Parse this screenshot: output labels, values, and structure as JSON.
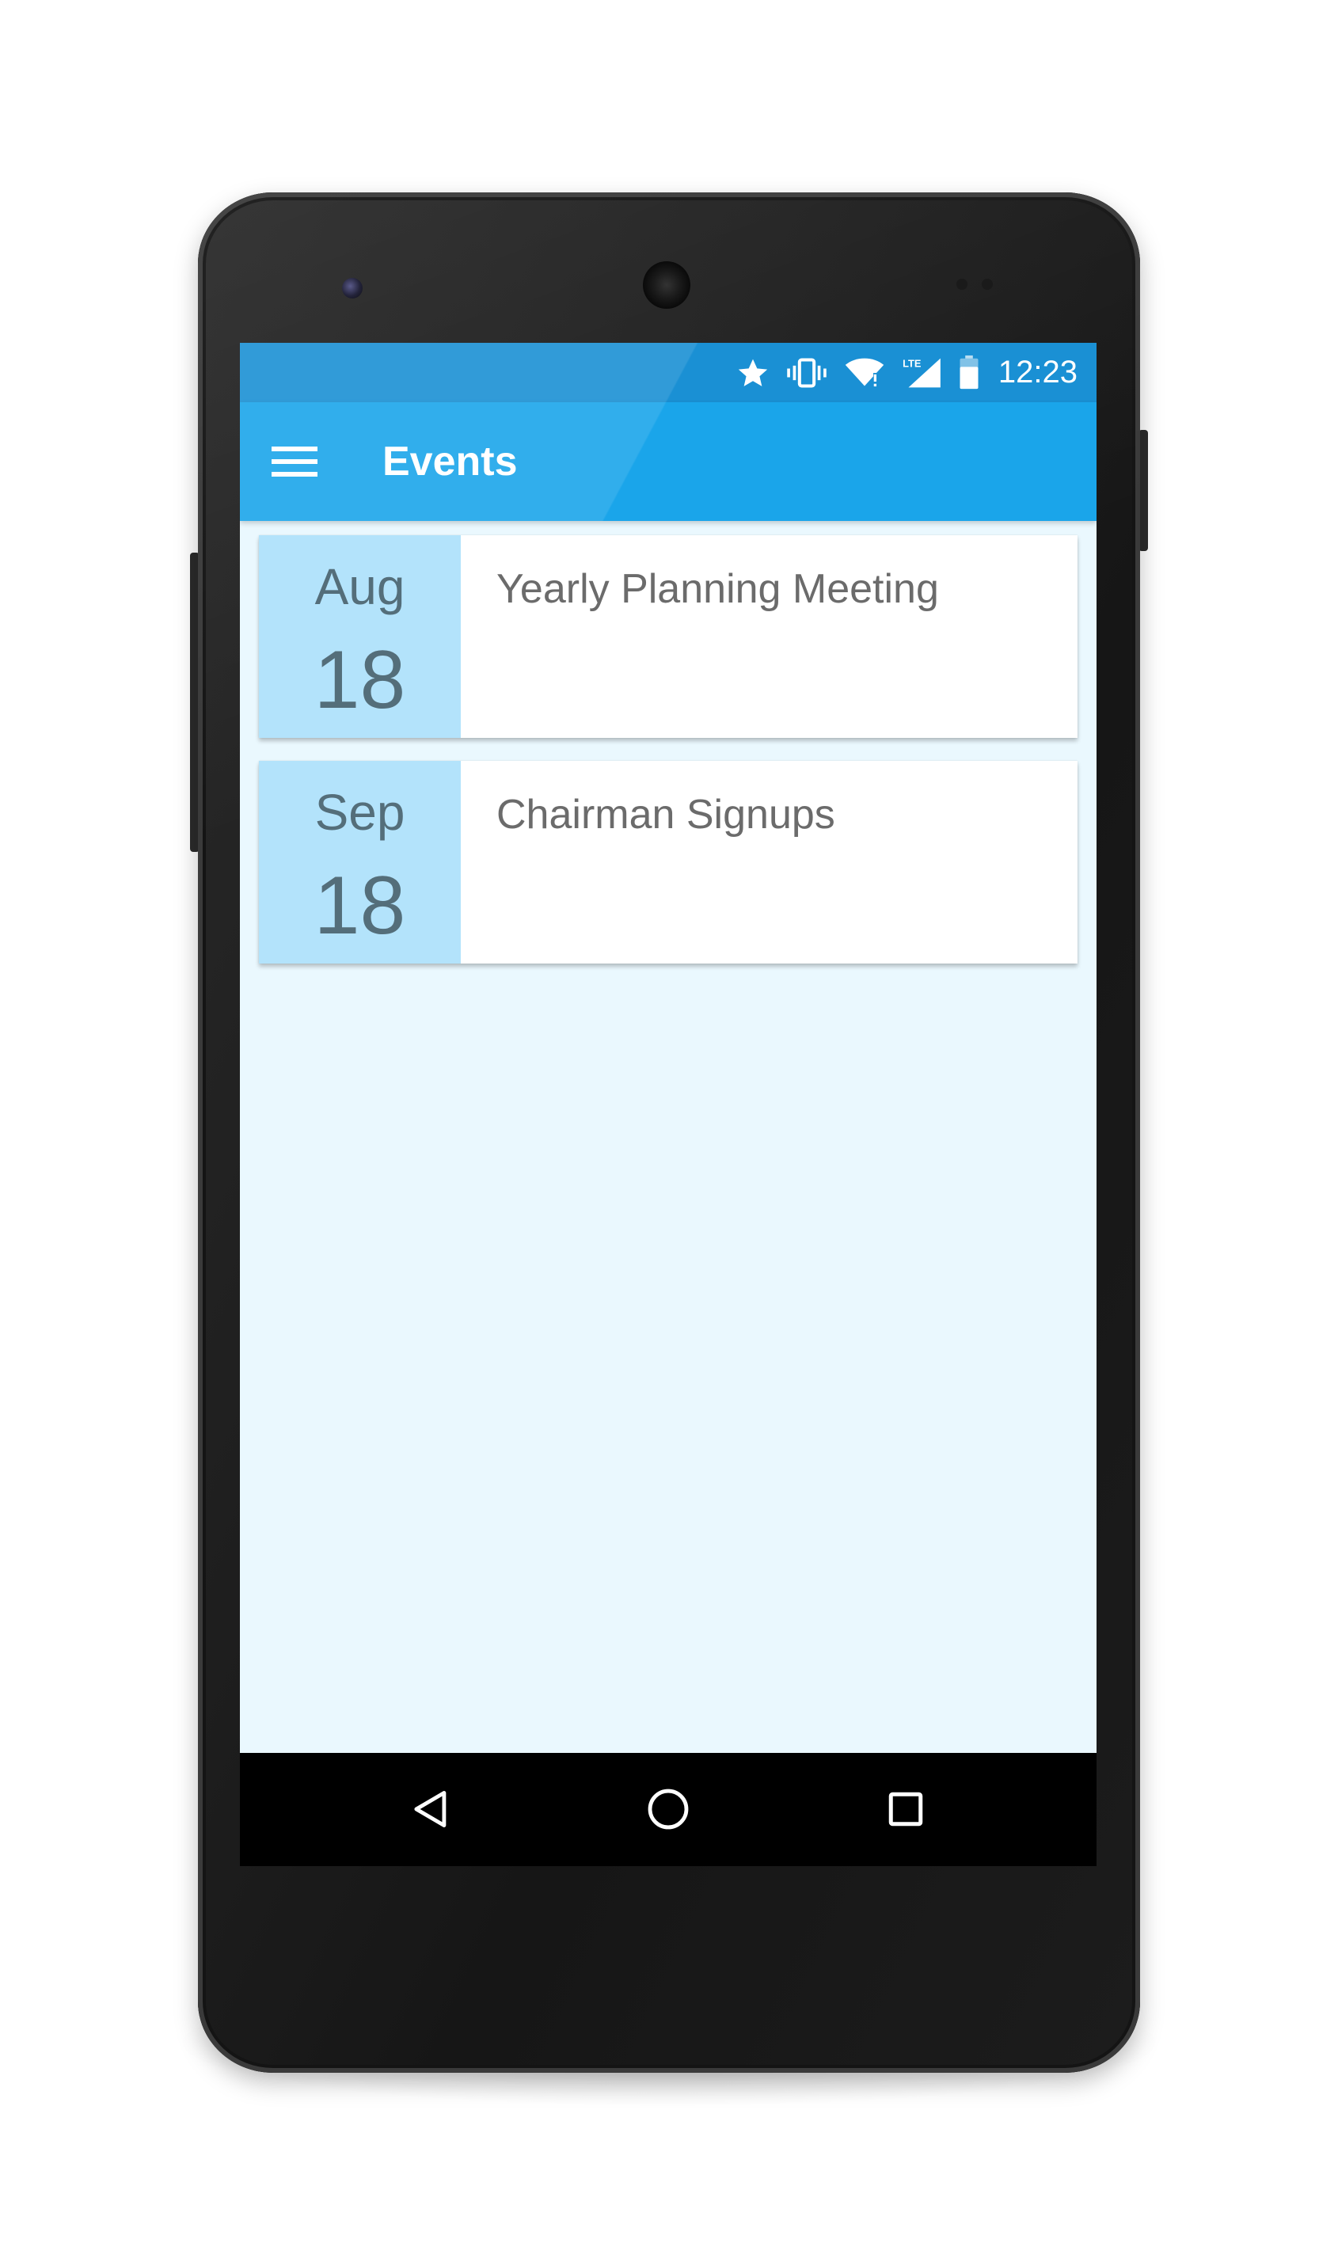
{
  "status_bar": {
    "time": "12:23",
    "network_label": "LTE"
  },
  "app_bar": {
    "title": "Events"
  },
  "events": [
    {
      "month": "Aug",
      "day": "18",
      "title": "Yearly Planning Meeting"
    },
    {
      "month": "Sep",
      "day": "18",
      "title": "Chairman Signups"
    }
  ],
  "icons": {
    "status": [
      "star-icon",
      "vibrate-icon",
      "wifi-icon",
      "lte-signal-icon",
      "battery-icon"
    ],
    "app_bar": [
      "menu-icon"
    ],
    "nav": [
      "back-icon",
      "home-icon",
      "recents-icon"
    ]
  },
  "colors": {
    "status_bar": "#1a90d4",
    "app_bar": "#1aa5ea",
    "screen_background": "#eaf8fe",
    "date_block": "#b3e3fb",
    "date_text": "#546e7a",
    "event_title_text": "#6b6b6b",
    "nav_bar": "#000000"
  }
}
